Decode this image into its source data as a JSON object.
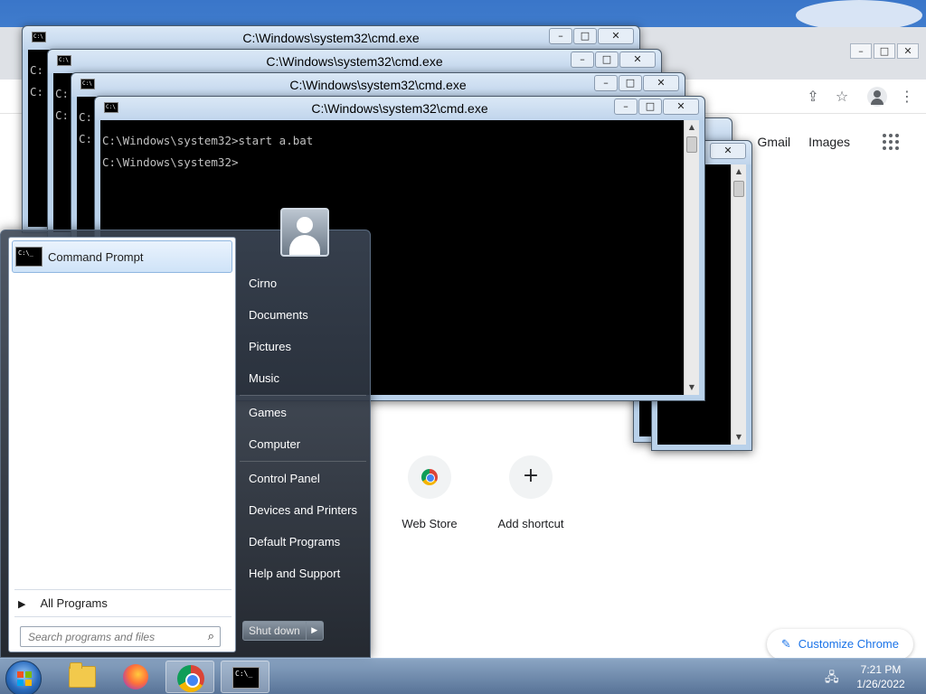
{
  "cmd_windows": [
    {
      "title": "C:\\Windows\\system32\\cmd.exe",
      "lines": [
        "C:",
        "C:"
      ]
    },
    {
      "title": "C:\\Windows\\system32\\cmd.exe",
      "lines": [
        "C:",
        "C:"
      ]
    },
    {
      "title": "C:\\Windows\\system32\\cmd.exe",
      "lines": [
        "C:",
        "C:"
      ]
    },
    {
      "title": "C:\\Windows\\system32\\cmd.exe",
      "lines": [
        "C:\\Windows\\system32>start a.bat",
        "C:\\Windows\\system32>"
      ]
    }
  ],
  "cmd_controls": {
    "minimize": "–",
    "maximize": "□",
    "close": "✕"
  },
  "chrome": {
    "links": {
      "gmail": "Gmail",
      "images": "Images"
    },
    "shortcuts": [
      {
        "label": "Web Store",
        "icon": "chrome-web-store-icon"
      },
      {
        "label": "Add shortcut",
        "icon": "plus-icon",
        "glyph": "+"
      }
    ],
    "customize_label": "Customize Chrome",
    "toolbar_icons": [
      "share-icon",
      "star-icon",
      "profile-icon",
      "menu-kebab-icon"
    ]
  },
  "start_menu": {
    "pinned": {
      "label": "Command Prompt",
      "icon": "command-prompt-icon"
    },
    "all_programs": "All Programs",
    "search_placeholder": "Search programs and files",
    "user_name": "Cirno",
    "right_items": [
      "Cirno",
      "Documents",
      "Pictures",
      "Music",
      "Games",
      "Computer",
      "Control Panel",
      "Devices and Printers",
      "Default Programs",
      "Help and Support"
    ],
    "shutdown_label": "Shut down"
  },
  "taskbar": {
    "items": [
      "file-explorer-icon",
      "firefox-icon",
      "chrome-icon",
      "command-prompt-icon"
    ],
    "time": "7:21 PM",
    "date": "1/26/2022"
  },
  "colors": {
    "accent": "#1a73e8",
    "cmd_bg": "#000000",
    "cmd_fg": "#c0c0c0"
  }
}
